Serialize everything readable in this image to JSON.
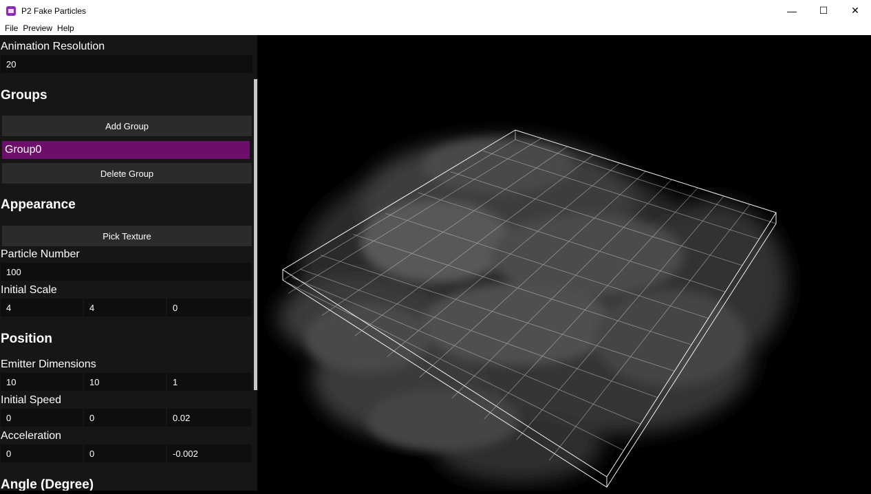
{
  "window": {
    "title": "P2 Fake Particles",
    "controls": {
      "minimize": "—",
      "maximize": "☐",
      "close": "✕"
    }
  },
  "menu": {
    "items": [
      "File",
      "Preview",
      "Help"
    ]
  },
  "panel": {
    "animation_resolution": {
      "label": "Animation Resolution",
      "value": "20"
    },
    "groups": {
      "heading": "Groups",
      "add_button": "Add Group",
      "items": [
        "Group0"
      ],
      "delete_button": "Delete Group"
    },
    "appearance": {
      "heading": "Appearance",
      "pick_texture_button": "Pick Texture",
      "particle_number": {
        "label": "Particle Number",
        "value": "100"
      },
      "initial_scale": {
        "label": "Initial Scale",
        "values": [
          "4",
          "4",
          "0"
        ]
      }
    },
    "position": {
      "heading": "Position",
      "emitter_dimensions": {
        "label": "Emitter Dimensions",
        "values": [
          "10",
          "10",
          "1"
        ]
      },
      "initial_speed": {
        "label": "Initial Speed",
        "values": [
          "0",
          "0",
          "0.02"
        ]
      },
      "acceleration": {
        "label": "Acceleration",
        "values": [
          "0",
          "0",
          "-0.002"
        ]
      }
    },
    "angle": {
      "heading": "Angle (Degree)"
    }
  },
  "colors": {
    "panel_bg": "#161616",
    "field_bg": "#0e0e0e",
    "button_bg": "#2b2b2b",
    "selected_group": "#6e0e6b",
    "viewport_bg": "#000000"
  }
}
